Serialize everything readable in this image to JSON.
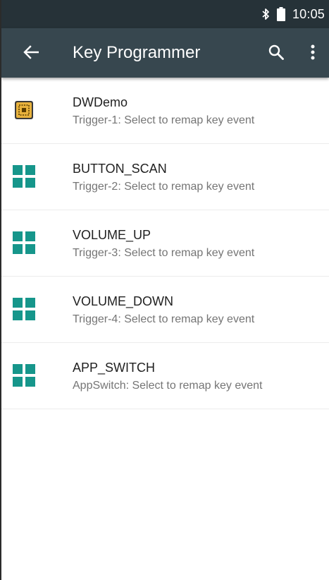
{
  "status_bar": {
    "time": "10:05",
    "icons": [
      "bluetooth-icon",
      "battery-icon"
    ]
  },
  "app_bar": {
    "title": "Key Programmer",
    "back_icon": "arrow-back-icon",
    "search_icon": "search-icon",
    "overflow_icon": "more-vert-icon",
    "background_color": "#37474f"
  },
  "items": [
    {
      "title": "DWDemo",
      "subtitle": "Trigger-1: Select to remap key event",
      "icon": "dwdemo-app-icon"
    },
    {
      "title": "BUTTON_SCAN",
      "subtitle": "Trigger-2: Select to remap key event",
      "icon": "grid-icon"
    },
    {
      "title": "VOLUME_UP",
      "subtitle": "Trigger-3: Select to remap key event",
      "icon": "grid-icon"
    },
    {
      "title": "VOLUME_DOWN",
      "subtitle": "Trigger-4: Select to remap key event",
      "icon": "grid-icon"
    },
    {
      "title": "APP_SWITCH",
      "subtitle": "AppSwitch: Select to remap key event",
      "icon": "grid-icon"
    }
  ],
  "colors": {
    "grid_icon": "#16968b",
    "dwdemo_icon": "#e8b23c"
  }
}
